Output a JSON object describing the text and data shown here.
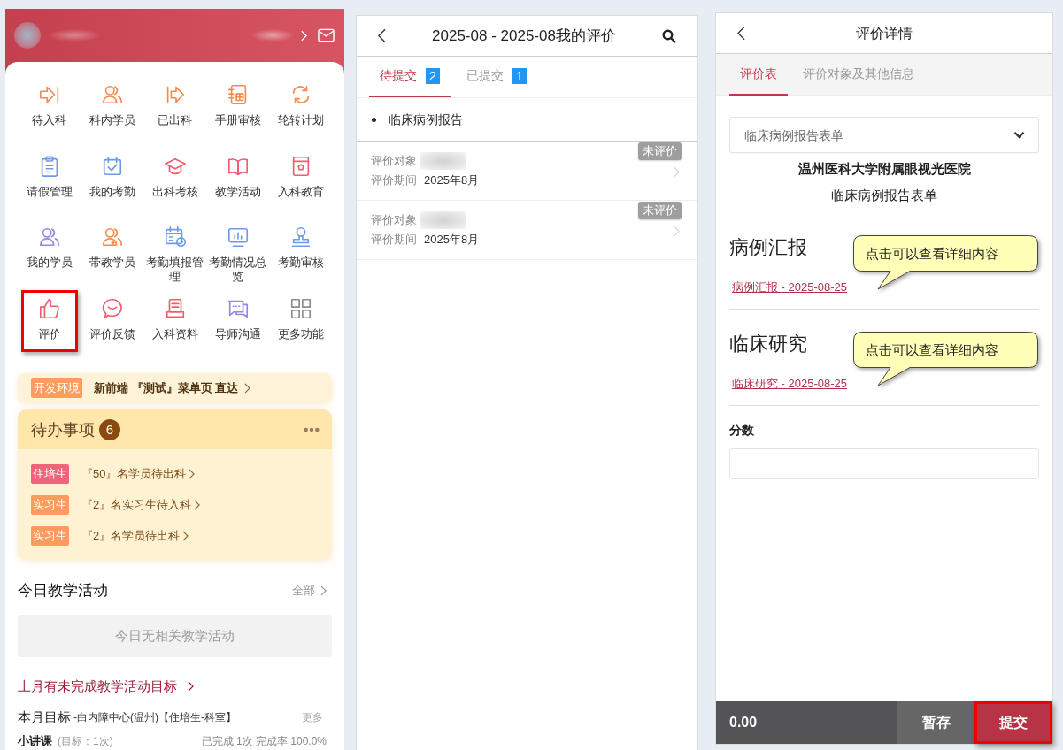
{
  "home": {
    "grid": [
      {
        "label": "待入科",
        "highlighted": false
      },
      {
        "label": "科内学员",
        "highlighted": false
      },
      {
        "label": "已出科",
        "highlighted": false
      },
      {
        "label": "手册审核",
        "highlighted": false
      },
      {
        "label": "轮转计划",
        "highlighted": false
      },
      {
        "label": "请假管理",
        "highlighted": false
      },
      {
        "label": "我的考勤",
        "highlighted": false
      },
      {
        "label": "出科考核",
        "highlighted": false
      },
      {
        "label": "教学活动",
        "highlighted": false
      },
      {
        "label": "入科教育",
        "highlighted": false
      },
      {
        "label": "我的学员",
        "highlighted": false
      },
      {
        "label": "带教学员",
        "highlighted": false
      },
      {
        "label": "考勤填报管理",
        "highlighted": false
      },
      {
        "label": "考勤情况总览",
        "highlighted": false
      },
      {
        "label": "考勤审核",
        "highlighted": false
      },
      {
        "label": "评价",
        "highlighted": true
      },
      {
        "label": "评价反馈",
        "highlighted": false
      },
      {
        "label": "入科资料",
        "highlighted": false
      },
      {
        "label": "导师沟通",
        "highlighted": false
      },
      {
        "label": "更多功能",
        "highlighted": false
      }
    ],
    "dev_banner": {
      "tag": "开发环境",
      "text": "新前端 『测试』菜单页 直达"
    },
    "todo": {
      "title": "待办事项",
      "count": "6",
      "items": [
        {
          "tag": "住培生",
          "color": "#f0637a",
          "text": "『50』名学员待出科"
        },
        {
          "tag": "实习生",
          "color": "#fb9c5e",
          "text": "『2』名实习生待入科"
        },
        {
          "tag": "实习生",
          "color": "#fb9c5e",
          "text": "『2』名学员待出科"
        }
      ]
    },
    "activities": {
      "title": "今日教学活动",
      "all_link": "全部",
      "empty_text": "今日无相关教学活动"
    },
    "unfinished_link": "上月有未完成教学活动目标",
    "monthly_goal": {
      "title": "本月目标",
      "scope": "-白内障中心(温州)【住培生-科室】",
      "more": "更多",
      "rows": [
        {
          "name": "小讲课",
          "target": "(目标：1次)",
          "progress": "已完成 1次 完成率 100.0%"
        }
      ]
    }
  },
  "evaluations": {
    "title": "2025-08 - 2025-08我的评价",
    "tabs": [
      {
        "label": "待提交",
        "count": "2",
        "selected": true
      },
      {
        "label": "已提交",
        "count": "1",
        "selected": false
      }
    ],
    "group": "临床病例报告",
    "items": [
      {
        "subject_label": "评价对象",
        "period_label": "评价期间",
        "period": "2025年8月",
        "status": "未评价"
      },
      {
        "subject_label": "评价对象",
        "period_label": "评价期间",
        "period": "2025年8月",
        "status": "未评价"
      }
    ]
  },
  "detail": {
    "title": "评价详情",
    "tabs": [
      {
        "label": "评价表",
        "selected": true
      },
      {
        "label": "评价对象及其他信息",
        "selected": false
      }
    ],
    "form_select": {
      "value": "临床病例报告表单"
    },
    "organization": "温州医科大学附属眼视光医院",
    "form_title": "临床病例报告表单",
    "sections": [
      {
        "title": "病例汇报",
        "link": "病例汇报 - 2025-08-25",
        "callout": "点击可以查看详细内容"
      },
      {
        "title": "临床研究",
        "link": "临床研究 - 2025-08-25",
        "callout": "点击可以查看详细内容"
      }
    ],
    "score": {
      "label": "分数"
    },
    "footer": {
      "total": "0.00",
      "buttons": [
        {
          "label": "暂存",
          "kind": "save",
          "highlighted": false
        },
        {
          "label": "提交",
          "kind": "submit",
          "highlighted": true
        }
      ]
    }
  }
}
